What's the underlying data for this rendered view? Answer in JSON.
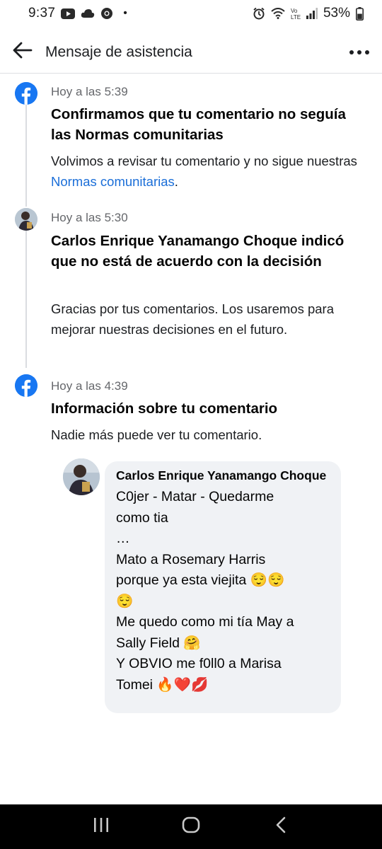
{
  "status_bar": {
    "time": "9:37",
    "dot": "•",
    "battery": "53%",
    "left_icons": [
      "youtube-icon",
      "cloud-icon",
      "chrome-icon"
    ],
    "right_icons": [
      "alarm-icon",
      "wifi-icon",
      "volte-icon",
      "signal-icon",
      "battery-icon"
    ]
  },
  "header": {
    "title": "Mensaje de asistencia",
    "back_icon": "arrow-left-icon",
    "more_icon": "more-dots-icon"
  },
  "timeline": [
    {
      "icon": "facebook-icon",
      "time": "Hoy a las 5:39",
      "title": "Confirmamos que tu comentario no seguía las Normas comunitarias",
      "body_pre": "Volvimos a revisar tu comentario y no sigue nuestras ",
      "body_link": "Normas comunitarias",
      "body_post": "."
    },
    {
      "icon": "user-avatar",
      "time": "Hoy a las 5:30",
      "title": "Carlos Enrique Yanamango Choque indicó que no está de acuerdo con la decisión",
      "body": "Gracias por tus comentarios. Los usaremos para mejorar nuestras decisiones en el futuro."
    },
    {
      "icon": "facebook-icon",
      "time": "Hoy a las 4:39",
      "title": "Información sobre tu comentario",
      "body": "Nadie más puede ver tu comentario."
    }
  ],
  "comment": {
    "author": "Carlos Enrique Yanamango Choque",
    "lines": [
      "C0jer - Matar - Quedarme",
      "como tia",
      "…",
      "Mato a Rosemary Harris",
      "porque ya esta viejita 😌😌",
      "😌",
      "Me quedo como mi tía May a",
      "Sally Field 🤗",
      "Y OBVIO me f0ll0 a Marisa",
      "Tomei 🔥❤️💋"
    ]
  },
  "nav_bar": {
    "recents_icon": "recents-icon",
    "home_icon": "home-icon",
    "back_icon": "back-chevron-icon"
  },
  "colors": {
    "facebook_blue": "#1877f2",
    "link_blue": "#1a6ed8",
    "bubble_bg": "#f0f2f5",
    "muted_text": "#65676b"
  }
}
